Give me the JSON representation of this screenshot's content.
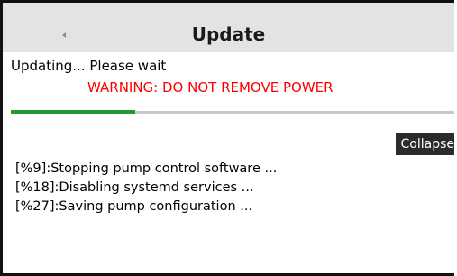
{
  "header": {
    "title": "Update",
    "back_icon": "chevron-left-icon"
  },
  "status": {
    "message": "Updating... Please wait",
    "warning": "WARNING: DO NOT REMOVE POWER",
    "warning_color": "#ff0000"
  },
  "progress": {
    "percent": 28,
    "fill_color": "#1d9c33"
  },
  "log_panel": {
    "collapse_label": "Collapse",
    "lines": [
      "[%9]:Stopping pump control software ...",
      "[%18]:Disabling systemd services ...",
      "[%27]:Saving pump configuration ..."
    ]
  }
}
